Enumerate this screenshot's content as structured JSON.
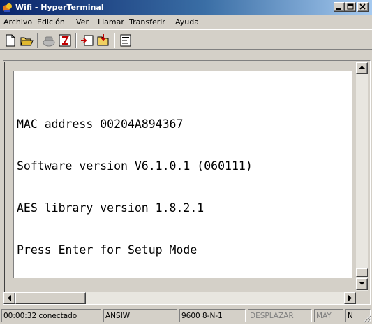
{
  "window": {
    "title": "Wifi - HyperTerminal"
  },
  "menu": {
    "items": [
      "Archivo",
      "Edición",
      "Ver",
      "Llamar",
      "Transferir",
      "Ayuda"
    ]
  },
  "toolbar": {
    "buttons": [
      "new-connection-icon",
      "open-folder-icon",
      "phone-icon",
      "disconnect-icon",
      "send-icon",
      "receive-icon",
      "properties-icon"
    ]
  },
  "terminal": {
    "lines": [
      "MAC address 00204A894367",
      "Software version V6.1.0.1 (060111)",
      "AES library version 1.8.2.1",
      "Press Enter for Setup Mode"
    ]
  },
  "status": {
    "connection": "00:00:32 conectado",
    "emulation": "ANSIW",
    "port_settings": "9600 8-N-1",
    "scroll": "DESPLAZAR",
    "caps": "MAY",
    "num": "N"
  },
  "colors": {
    "titlebar_start": "#0a246a",
    "titlebar_end": "#a6caf0",
    "face": "#d4d0c8",
    "screen": "#ffffff"
  }
}
